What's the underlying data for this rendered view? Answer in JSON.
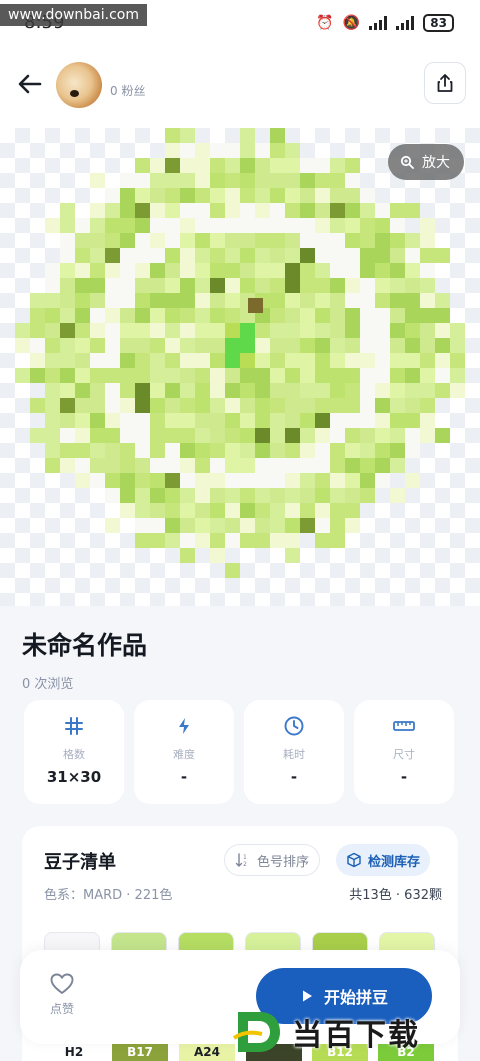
{
  "status_bar": {
    "time": "8:59",
    "battery": "83",
    "watermark": "www.downbai.com"
  },
  "header": {
    "fans": "0 粉丝"
  },
  "canvas": {
    "zoom_label": "放大"
  },
  "artwork": {
    "title": "未命名作品",
    "views": "0 次浏览"
  },
  "stats": [
    {
      "icon": "grid-icon",
      "label": "格数",
      "value": "31×30"
    },
    {
      "icon": "bolt-icon",
      "label": "难度",
      "value": "-"
    },
    {
      "icon": "clock-icon",
      "label": "耗时",
      "value": "-"
    },
    {
      "icon": "ruler-icon",
      "label": "尺寸",
      "value": "-"
    }
  ],
  "bead_list": {
    "title": "豆子清单",
    "sort_label": "色号排序",
    "check_label": "检测库存",
    "palette_info": "色系：MARD · 221色",
    "count_info": "共13色 · 632颗",
    "swatch_colors": [
      "#f7f7fa",
      "#c4e58c",
      "#b5de63",
      "#d6f19a",
      "#a9cf4a",
      "#e3f5a6"
    ],
    "codes": [
      "H2",
      "B17",
      "A24",
      "",
      "B12",
      "B2"
    ]
  },
  "bottom_bar": {
    "like_label": "点赞",
    "start_label": "开始拼豆"
  },
  "logo_watermark": {
    "text": "当百下载"
  },
  "colors": {
    "accent": "#1a5fbe",
    "accent_light": "#e7f0fb",
    "icon_blue": "#3a78c9"
  }
}
